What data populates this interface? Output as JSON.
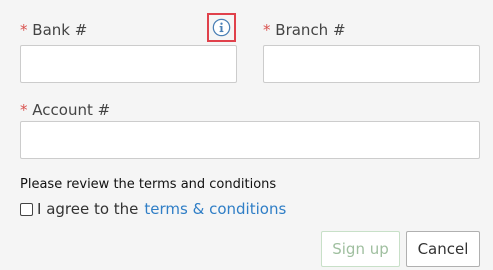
{
  "form": {
    "bank": {
      "required_mark": "*",
      "label": "Bank #",
      "value": "",
      "placeholder": ""
    },
    "branch": {
      "required_mark": "*",
      "label": "Branch #",
      "value": "",
      "placeholder": ""
    },
    "account": {
      "required_mark": "*",
      "label": "Account #",
      "value": "",
      "placeholder": ""
    },
    "info_icon": "info-circle-icon",
    "terms": {
      "note": "Please review the terms and conditions",
      "agree_text": "I agree to the",
      "link_text": "terms & conditions",
      "checked": false
    },
    "buttons": {
      "signup": "Sign up",
      "cancel": "Cancel"
    }
  },
  "colors": {
    "required": "#d9534f",
    "link": "#2f7ec6",
    "highlight": "#e0414b",
    "info_icon": "#4a7fb5",
    "signup_disabled_text": "#9fbf9f",
    "background": "#f5f5f5"
  }
}
